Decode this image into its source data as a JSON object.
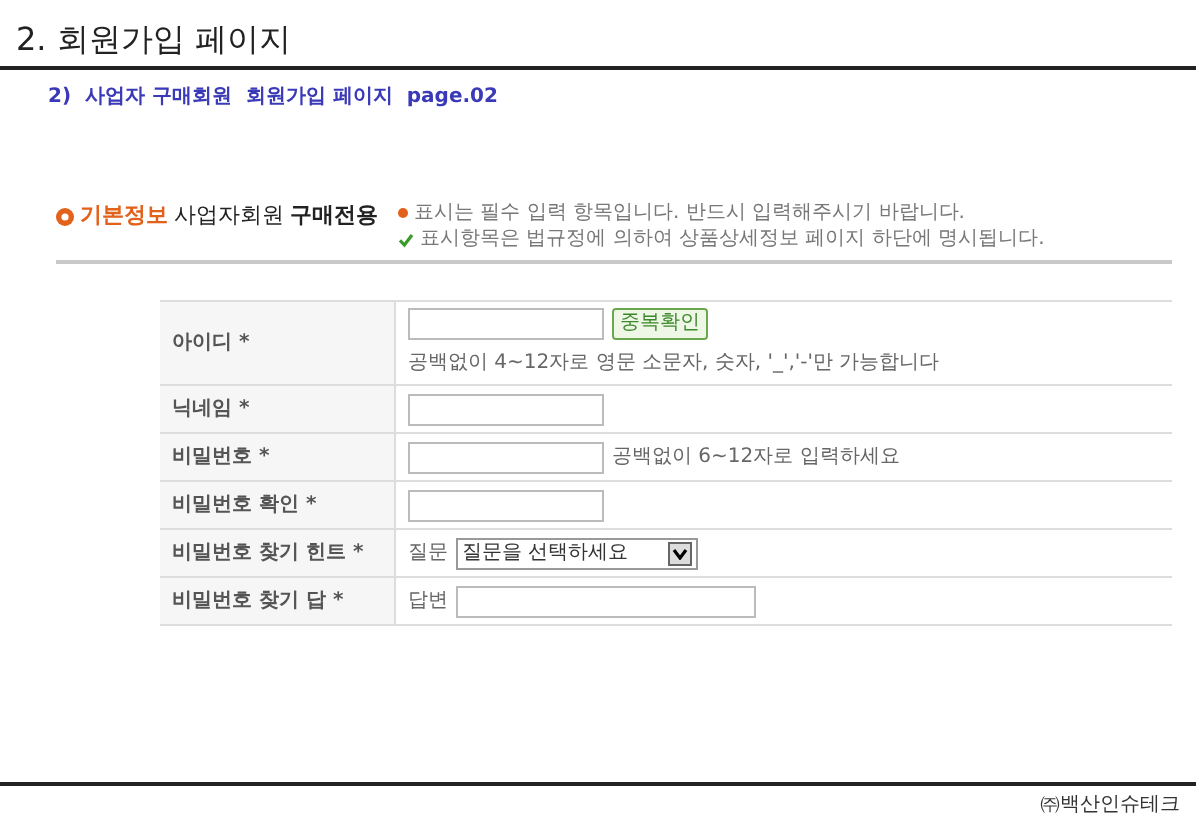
{
  "page_title": "2. 회원가입 페이지",
  "subtitle": "2)  사업자 구매회원  회원가입 페이지  page.02",
  "section": {
    "title_highlight": "기본정보",
    "title_sub": "사업자회원",
    "title_bold": "구매전용",
    "notices": [
      {
        "kind": "required",
        "text": "표시는 필수 입력 항목입니다. 반드시 입력해주시기 바랍니다."
      },
      {
        "kind": "disclosed",
        "text": "표시항목은 법규정에 의하여 상품상세정보 페이지 하단에 명시됩니다."
      }
    ]
  },
  "fields": [
    {
      "label": "아이디 *",
      "kind": "text",
      "button": "중복확인",
      "hint": "공백없이 4~12자로 영문 소문자, 숫자, '_','-'만 가능합니다"
    },
    {
      "label": "닉네임 *",
      "kind": "text"
    },
    {
      "label": "비밀번호 *",
      "kind": "text",
      "hint": "공백없이 6~12자로 입력하세요"
    },
    {
      "label": "비밀번호 확인 *",
      "kind": "text"
    },
    {
      "label": "비밀번호 찾기 힌트 *",
      "kind": "select",
      "prefix": "질문",
      "value": "질문을 선택하세요"
    },
    {
      "label": "비밀번호 찾기 답 *",
      "kind": "wide",
      "prefix": "답변"
    }
  ],
  "footer": "㈜백산인슈테크"
}
